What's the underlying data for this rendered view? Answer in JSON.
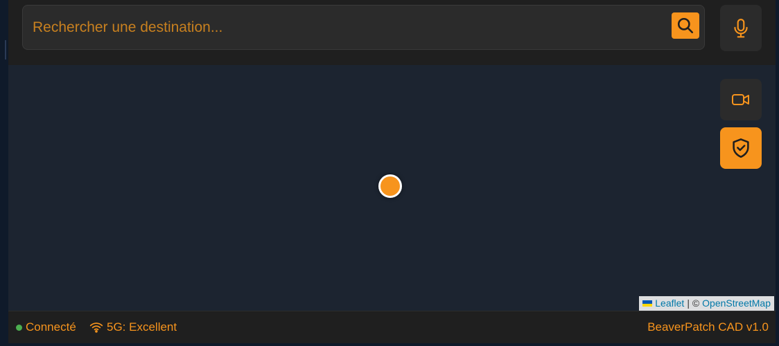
{
  "search": {
    "placeholder": "Rechercher une destination...",
    "value": ""
  },
  "icons": {
    "search": "search-icon",
    "mic": "microphone-icon",
    "video": "video-camera-icon",
    "shield": "shield-check-icon",
    "wifi": "wifi-icon",
    "flag": "ukraine-flag-icon"
  },
  "attribution": {
    "leaflet": "Leaflet",
    "separator": "| ©",
    "osm": "OpenStreetMap"
  },
  "status": {
    "connection": "Connecté",
    "network": "5G: Excellent",
    "version": "BeaverPatch CAD v1.0"
  },
  "colors": {
    "accent": "#f7941d",
    "map_background": "#1c2430",
    "panel": "#1f1f1f",
    "connected": "#4caf50"
  }
}
